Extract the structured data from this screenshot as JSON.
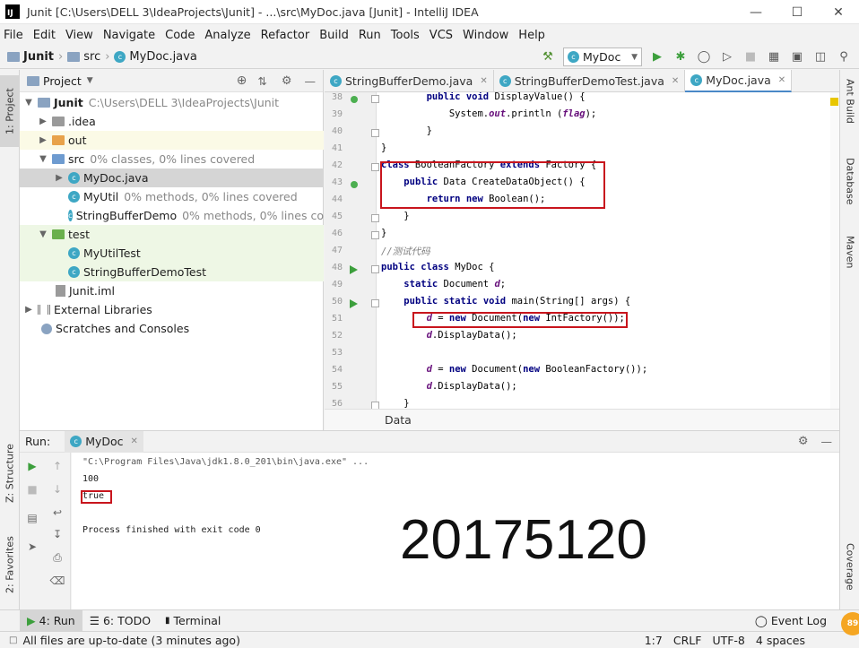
{
  "title": "Junit [C:\\Users\\DELL 3\\IdeaProjects\\Junit] - ...\\src\\MyDoc.java [Junit] - IntelliJ IDEA",
  "menu": [
    "File",
    "Edit",
    "View",
    "Navigate",
    "Code",
    "Analyze",
    "Refactor",
    "Build",
    "Run",
    "Tools",
    "VCS",
    "Window",
    "Help"
  ],
  "breadcrumb": [
    "Junit",
    "src",
    "MyDoc.java"
  ],
  "run_config": "MyDoc",
  "left_stripe": {
    "project": "1: Project",
    "structure": "Z: Structure",
    "favorites": "2: Favorites"
  },
  "right_stripe": {
    "ant": "Ant Build",
    "database": "Database",
    "maven": "Maven",
    "coverage": "Coverage"
  },
  "project": {
    "header": "Project",
    "tree": [
      {
        "label": "Junit",
        "note": "C:\\Users\\DELL 3\\IdeaProjects\\Junit"
      },
      {
        "label": ".idea",
        "note": ""
      },
      {
        "label": "out",
        "note": ""
      },
      {
        "label": "src",
        "note": "0% classes, 0% lines covered"
      },
      {
        "label": "MyDoc.java",
        "note": ""
      },
      {
        "label": "MyUtil",
        "note": "0% methods, 0% lines covered"
      },
      {
        "label": "StringBufferDemo",
        "note": "0% methods, 0% lines co"
      },
      {
        "label": "test",
        "note": ""
      },
      {
        "label": "MyUtilTest",
        "note": ""
      },
      {
        "label": "StringBufferDemoTest",
        "note": ""
      },
      {
        "label": "Junit.iml",
        "note": ""
      },
      {
        "label": "External Libraries",
        "note": ""
      },
      {
        "label": "Scratches and Consoles",
        "note": ""
      }
    ]
  },
  "tabs": [
    "StringBufferDemo.java",
    "StringBufferDemoTest.java",
    "MyDoc.java"
  ],
  "editor": {
    "line_numbers": [
      "38",
      "39",
      "40",
      "41",
      "42",
      "43",
      "44",
      "45",
      "46",
      "47",
      "48",
      "49",
      "50",
      "51",
      "52",
      "53",
      "54",
      "55",
      "56"
    ],
    "lines": [
      "        public void DisplayValue() {",
      "            System.out.println (flag);",
      "        }",
      "}",
      "class BooleanFactory extends Factory {",
      "    public Data CreateDataObject() {",
      "        return new Boolean();",
      "    }",
      "}",
      "//测试代码",
      "public class MyDoc {",
      "    static Document d;",
      "    public static void main(String[] args) {",
      "        d = new Document(new IntFactory());",
      "        d.DisplayData();",
      "",
      "        d = new Document(new BooleanFactory());",
      "        d.DisplayData();",
      "    }"
    ],
    "breadcrumb": "Data"
  },
  "run": {
    "label": "Run:",
    "tab": "MyDoc",
    "console": [
      "\"C:\\Program Files\\Java\\jdk1.8.0_201\\bin\\java.exe\" ...",
      "100",
      "true",
      "",
      "Process finished with exit code 0"
    ],
    "student_id": "20175120"
  },
  "bottom_tabs": [
    "4: Run",
    "6: TODO",
    "Terminal"
  ],
  "event_log": "Event Log",
  "badge": "89",
  "status": {
    "message": "All files are up-to-date (3 minutes ago)",
    "position": "1:7",
    "line_sep": "CRLF",
    "encoding": "UTF-8",
    "indent": "4 spaces"
  }
}
